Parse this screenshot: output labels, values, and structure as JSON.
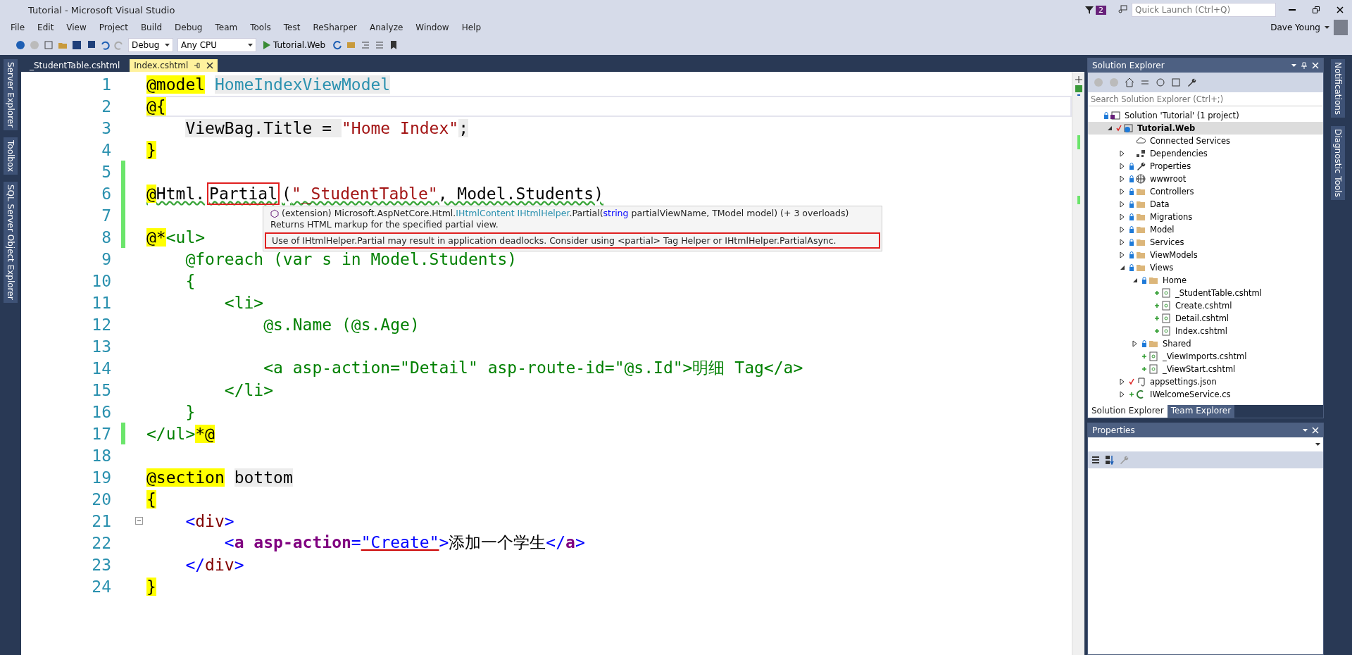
{
  "window": {
    "title": "Tutorial - Microsoft Visual Studio",
    "notification_count": "2",
    "quick_launch": {
      "placeholder": "Quick Launch (Ctrl+Q)"
    },
    "user": "Dave Young"
  },
  "menu": [
    "File",
    "Edit",
    "View",
    "Project",
    "Build",
    "Debug",
    "Team",
    "Tools",
    "Test",
    "ReSharper",
    "Analyze",
    "Window",
    "Help"
  ],
  "toolbar": {
    "configuration": "Debug",
    "platform": "Any CPU",
    "run_target": "Tutorial.Web"
  },
  "left_strip": [
    "Server Explorer",
    "Toolbox",
    "SQL Server Object Explorer"
  ],
  "right_strip": [
    "Notifications",
    "Diagnostic Tools"
  ],
  "editor_tabs": [
    {
      "label": "_StudentTable.cshtml",
      "selected": false
    },
    {
      "label": "Index.cshtml",
      "selected": true
    }
  ],
  "code": [
    {
      "number": "1",
      "changed": false,
      "current": false,
      "squiggle": false,
      "fold": false,
      "tokens": [
        {
          "kind": "razor",
          "text": "@model"
        },
        {
          "kind": "type",
          "text": " HomeIndexViewModel"
        }
      ]
    },
    {
      "number": "2",
      "changed": false,
      "current": true,
      "squiggle": false,
      "fold": false,
      "tokens": [
        {
          "kind": "razor",
          "text": "@{"
        }
      ]
    },
    {
      "number": "3",
      "changed": false,
      "current": false,
      "squiggle": false,
      "fold": false,
      "tokens": [
        {
          "kind": "csharp",
          "text": "    ViewBag.Title = "
        },
        {
          "kind": "string",
          "text": "\"Home Index\""
        },
        {
          "kind": "csharp",
          "text": ";"
        }
      ]
    },
    {
      "number": "4",
      "changed": false,
      "current": false,
      "squiggle": false,
      "fold": false,
      "tokens": [
        {
          "kind": "razor",
          "text": "}"
        }
      ]
    },
    {
      "number": "5",
      "changed": true,
      "current": false,
      "squiggle": false,
      "fold": false
    },
    {
      "number": "6",
      "changed": true,
      "current": false,
      "squiggle": true,
      "fold": false,
      "tokens": [
        {
          "kind": "razor",
          "text": "@"
        },
        {
          "kind": "plain",
          "text": "Html."
        },
        {
          "kind": "plain",
          "text": "Partial",
          "marked": true
        },
        {
          "kind": "plain",
          "text": "("
        },
        {
          "kind": "string",
          "text": "\"_StudentTable\""
        },
        {
          "kind": "plain",
          "text": ", Model.Students)"
        }
      ]
    },
    {
      "number": "7",
      "changed": true,
      "current": false,
      "squiggle": false,
      "fold": false
    },
    {
      "number": "8",
      "changed": true,
      "current": false,
      "squiggle": false,
      "fold": false,
      "tokens": [
        {
          "kind": "razor",
          "text": "@*"
        },
        {
          "kind": "comment",
          "text": "<ul>"
        }
      ]
    },
    {
      "number": "9",
      "changed": false,
      "current": false,
      "squiggle": false,
      "fold": false,
      "tokens": [
        {
          "kind": "comment",
          "text": "    @foreach (var s in Model.Students)"
        }
      ]
    },
    {
      "number": "10",
      "changed": false,
      "current": false,
      "squiggle": false,
      "fold": false,
      "tokens": [
        {
          "kind": "comment",
          "text": "    {"
        }
      ]
    },
    {
      "number": "11",
      "changed": false,
      "current": false,
      "squiggle": false,
      "fold": false,
      "tokens": [
        {
          "kind": "comment",
          "text": "        <li>"
        }
      ]
    },
    {
      "number": "12",
      "changed": false,
      "current": false,
      "squiggle": false,
      "fold": false,
      "tokens": [
        {
          "kind": "comment",
          "text": "            @s.Name (@s.Age)"
        }
      ]
    },
    {
      "number": "13",
      "changed": false,
      "current": false,
      "squiggle": false,
      "fold": false
    },
    {
      "number": "14",
      "changed": false,
      "current": false,
      "squiggle": false,
      "fold": false,
      "tokens": [
        {
          "kind": "comment",
          "text": "            <a asp-action=\"Detail\" asp-route-id=\"@s.Id\">明细 Tag</a>"
        }
      ]
    },
    {
      "number": "15",
      "changed": false,
      "current": false,
      "squiggle": false,
      "fold": false,
      "tokens": [
        {
          "kind": "comment",
          "text": "        </li>"
        }
      ]
    },
    {
      "number": "16",
      "changed": false,
      "current": false,
      "squiggle": false,
      "fold": false,
      "tokens": [
        {
          "kind": "comment",
          "text": "    }"
        }
      ]
    },
    {
      "number": "17",
      "changed": true,
      "current": false,
      "squiggle": false,
      "fold": false,
      "tokens": [
        {
          "kind": "comment",
          "text": "</ul>"
        },
        {
          "kind": "razor",
          "text": "*@"
        }
      ]
    },
    {
      "number": "18",
      "changed": false,
      "current": false,
      "squiggle": false,
      "fold": false
    },
    {
      "number": "19",
      "changed": false,
      "current": false,
      "squiggle": false,
      "fold": false,
      "tokens": [
        {
          "kind": "razor",
          "text": "@section"
        },
        {
          "kind": "csharp",
          "text": " bottom"
        }
      ]
    },
    {
      "number": "20",
      "changed": false,
      "current": false,
      "squiggle": false,
      "fold": false,
      "tokens": [
        {
          "kind": "razor",
          "text": "{"
        }
      ]
    },
    {
      "number": "21",
      "changed": false,
      "current": false,
      "squiggle": false,
      "fold": true,
      "tokens": [
        {
          "kind": "delim",
          "text": "    <"
        },
        {
          "kind": "tag",
          "text": "div"
        },
        {
          "kind": "delim",
          "text": ">"
        }
      ]
    },
    {
      "number": "22",
      "changed": false,
      "current": false,
      "squiggle": false,
      "fold": false,
      "tokens": [
        {
          "kind": "delim",
          "text": "        <"
        },
        {
          "kind": "tagbold",
          "text": "a"
        },
        {
          "kind": "attr",
          "text": " asp-action"
        },
        {
          "kind": "delim",
          "text": "="
        },
        {
          "kind": "value",
          "text": "\"Create\""
        },
        {
          "kind": "delim",
          "text": ">"
        },
        {
          "kind": "plain",
          "text": "添加一个学生"
        },
        {
          "kind": "delim",
          "text": "</"
        },
        {
          "kind": "tagbold",
          "text": "a"
        },
        {
          "kind": "delim",
          "text": ">"
        }
      ]
    },
    {
      "number": "23",
      "changed": false,
      "current": false,
      "squiggle": false,
      "fold": false,
      "tokens": [
        {
          "kind": "delim",
          "text": "    </"
        },
        {
          "kind": "tag",
          "text": "div"
        },
        {
          "kind": "delim",
          "text": ">"
        }
      ]
    },
    {
      "number": "24",
      "changed": false,
      "current": false,
      "squiggle": false,
      "fold": false,
      "tokens": [
        {
          "kind": "razor",
          "text": "}"
        }
      ]
    }
  ],
  "tooltip": {
    "signature": [
      {
        "kind": "plain",
        "text": "(extension) Microsoft.AspNetCore.Html."
      },
      {
        "kind": "type",
        "text": "IHtmlContent IHtmlHelper"
      },
      {
        "kind": "plain",
        "text": ".Partial("
      },
      {
        "kind": "keyword",
        "text": "string"
      },
      {
        "kind": "plain",
        "text": " partialViewName, TModel model) (+ 3 overloads)"
      }
    ],
    "description": "Returns HTML markup for the specified partial view.",
    "warning": "Use of IHtmlHelper.Partial may result in application deadlocks. Consider using <partial> Tag Helper or IHtmlHelper.PartialAsync."
  },
  "solution_explorer": {
    "title": "Solution Explorer",
    "search": {
      "placeholder": "Search Solution Explorer (Ctrl+;)"
    },
    "tree": [
      {
        "label": "Solution 'Tutorial' (1 project)",
        "kind": "solution",
        "locked": true,
        "pending_edit": false,
        "pending_add": false,
        "expandable": false,
        "expanded": true,
        "selected": false,
        "children": [
          {
            "label": "Tutorial.Web",
            "kind": "project",
            "locked": false,
            "pending_edit": true,
            "pending_add": false,
            "expandable": true,
            "expanded": true,
            "selected": true,
            "children": [
              {
                "label": "Connected Services",
                "kind": "cloud",
                "locked": false,
                "pending_edit": false,
                "pending_add": false,
                "expandable": false,
                "expanded": false,
                "selected": false
              },
              {
                "label": "Dependencies",
                "kind": "dependencies",
                "locked": false,
                "pending_edit": false,
                "pending_add": false,
                "expandable": true,
                "expanded": false,
                "selected": false
              },
              {
                "label": "Properties",
                "kind": "properties",
                "locked": true,
                "pending_edit": false,
                "pending_add": false,
                "expandable": true,
                "expanded": false,
                "selected": false
              },
              {
                "label": "wwwroot",
                "kind": "web",
                "locked": true,
                "pending_edit": false,
                "pending_add": false,
                "expandable": true,
                "expanded": false,
                "selected": false
              },
              {
                "label": "Controllers",
                "kind": "folder",
                "locked": true,
                "pending_edit": false,
                "pending_add": false,
                "expandable": true,
                "expanded": false,
                "selected": false
              },
              {
                "label": "Data",
                "kind": "folder",
                "locked": true,
                "pending_edit": false,
                "pending_add": false,
                "expandable": true,
                "expanded": false,
                "selected": false
              },
              {
                "label": "Migrations",
                "kind": "folder",
                "locked": true,
                "pending_edit": false,
                "pending_add": false,
                "expandable": true,
                "expanded": false,
                "selected": false
              },
              {
                "label": "Model",
                "kind": "folder",
                "locked": true,
                "pending_edit": false,
                "pending_add": false,
                "expandable": true,
                "expanded": false,
                "selected": false
              },
              {
                "label": "Services",
                "kind": "folder",
                "locked": true,
                "pending_edit": false,
                "pending_add": false,
                "expandable": true,
                "expanded": false,
                "selected": false
              },
              {
                "label": "ViewModels",
                "kind": "folder",
                "locked": true,
                "pending_edit": false,
                "pending_add": false,
                "expandable": true,
                "expanded": false,
                "selected": false
              },
              {
                "label": "Views",
                "kind": "folder",
                "locked": true,
                "pending_edit": false,
                "pending_add": false,
                "expandable": true,
                "expanded": true,
                "selected": false,
                "children": [
                  {
                    "label": "Home",
                    "kind": "folder",
                    "locked": true,
                    "pending_edit": false,
                    "pending_add": false,
                    "expandable": true,
                    "expanded": true,
                    "selected": false,
                    "children": [
                      {
                        "label": "_StudentTable.cshtml",
                        "kind": "razor",
                        "locked": false,
                        "pending_edit": false,
                        "pending_add": true,
                        "expandable": false,
                        "expanded": false,
                        "selected": false
                      },
                      {
                        "label": "Create.cshtml",
                        "kind": "razor",
                        "locked": false,
                        "pending_edit": false,
                        "pending_add": true,
                        "expandable": false,
                        "expanded": false,
                        "selected": false
                      },
                      {
                        "label": "Detail.cshtml",
                        "kind": "razor",
                        "locked": false,
                        "pending_edit": false,
                        "pending_add": true,
                        "expandable": false,
                        "expanded": false,
                        "selected": false
                      },
                      {
                        "label": "Index.cshtml",
                        "kind": "razor",
                        "locked": false,
                        "pending_edit": false,
                        "pending_add": true,
                        "expandable": false,
                        "expanded": false,
                        "selected": false
                      }
                    ]
                  },
                  {
                    "label": "Shared",
                    "kind": "folder",
                    "locked": true,
                    "pending_edit": false,
                    "pending_add": false,
                    "expandable": true,
                    "expanded": false,
                    "selected": false
                  },
                  {
                    "label": "_ViewImports.cshtml",
                    "kind": "razor",
                    "locked": false,
                    "pending_edit": false,
                    "pending_add": true,
                    "expandable": false,
                    "expanded": false,
                    "selected": false
                  },
                  {
                    "label": "_ViewStart.cshtml",
                    "kind": "razor",
                    "locked": false,
                    "pending_edit": false,
                    "pending_add": true,
                    "expandable": false,
                    "expanded": false,
                    "selected": false
                  }
                ]
              },
              {
                "label": "appsettings.json",
                "kind": "json",
                "locked": false,
                "pending_edit": true,
                "pending_add": false,
                "expandable": true,
                "expanded": false,
                "selected": false
              },
              {
                "label": "IWelcomeService.cs",
                "kind": "csharp",
                "locked": false,
                "pending_edit": false,
                "pending_add": true,
                "expandable": true,
                "expanded": false,
                "selected": false
              }
            ]
          }
        ]
      }
    ],
    "tabs": [
      {
        "label": "Solution Explorer",
        "selected": true
      },
      {
        "label": "Team Explorer",
        "selected": false
      }
    ]
  },
  "properties": {
    "title": "Properties"
  }
}
